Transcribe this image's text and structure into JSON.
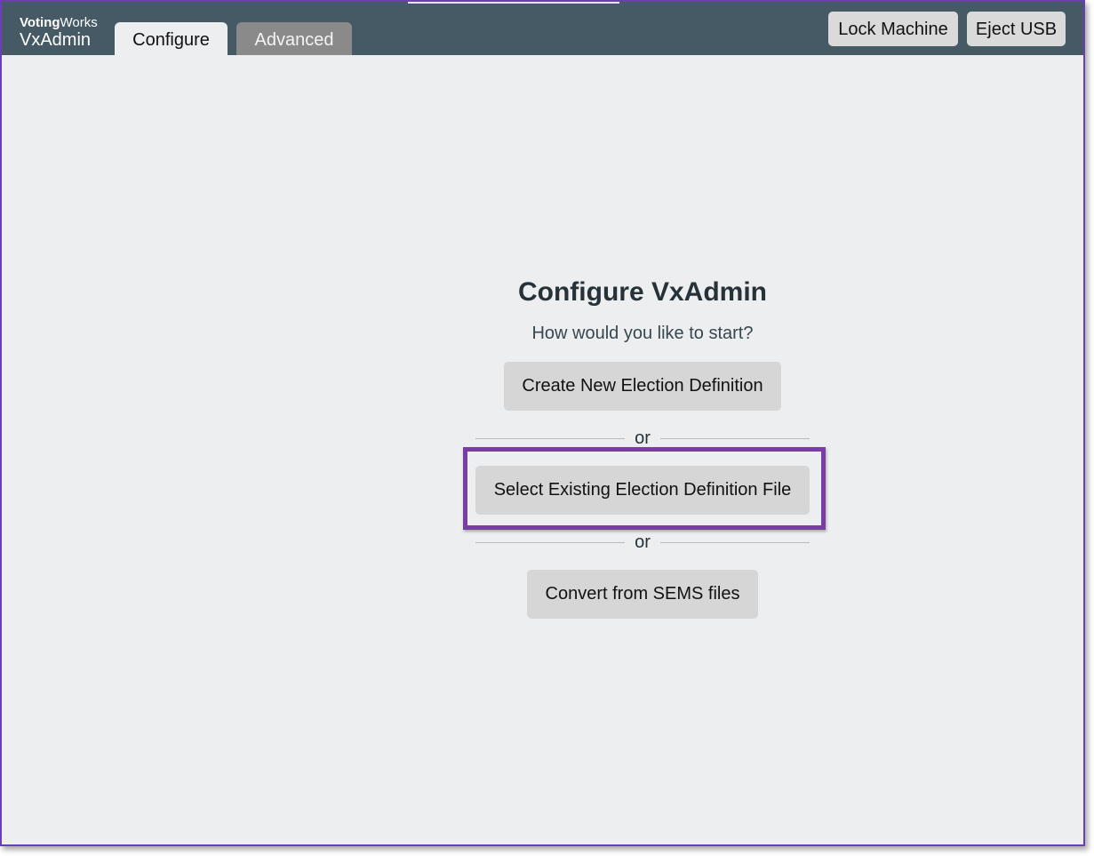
{
  "header": {
    "brand_org_bold": "Voting",
    "brand_org_regular": "Works",
    "brand_app": "VxAdmin",
    "tabs": [
      {
        "label": "Configure",
        "active": true
      },
      {
        "label": "Advanced",
        "active": false
      }
    ],
    "lock_label": "Lock Machine",
    "eject_label": "Eject USB"
  },
  "main": {
    "title": "Configure VxAdmin",
    "subtitle": "How would you like to start?",
    "create_label": "Create New Election Definition",
    "divider_1": "or",
    "select_label": "Select Existing Election Definition File",
    "divider_2": "or",
    "convert_label": "Convert from SEMS files"
  },
  "colors": {
    "topbar": "#455a64",
    "background": "#edeef0",
    "highlight": "#7a3ca6",
    "button": "#d6d6d6"
  }
}
